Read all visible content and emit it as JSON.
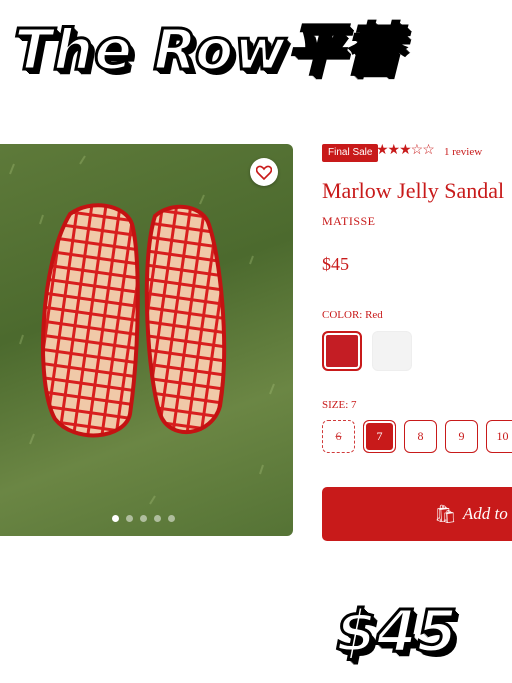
{
  "banner": {
    "headline": "The Row平替",
    "price": "$45"
  },
  "product": {
    "badge": "Final Sale",
    "stars": "★★★☆☆",
    "rating": 3,
    "reviews": "1 review",
    "title": "Marlow Jelly Sandal",
    "brand": "MATISSE",
    "price": "$45",
    "color_label": "COLOR: Red",
    "colors": [
      "Red",
      "White"
    ],
    "size_label": "SIZE: 7",
    "sizes": [
      "6",
      "7",
      "8",
      "9",
      "10"
    ],
    "add_to_bag": "Add to Bag",
    "bag_icon": "shopping-bag-icon"
  },
  "gallery": {
    "slides": 5,
    "active": 1,
    "wishlist_icon": "heart-icon"
  },
  "colors": {
    "accent": "#c81a1a",
    "swatch_red": "#c41d24",
    "swatch_white": "#f3f3f3"
  }
}
